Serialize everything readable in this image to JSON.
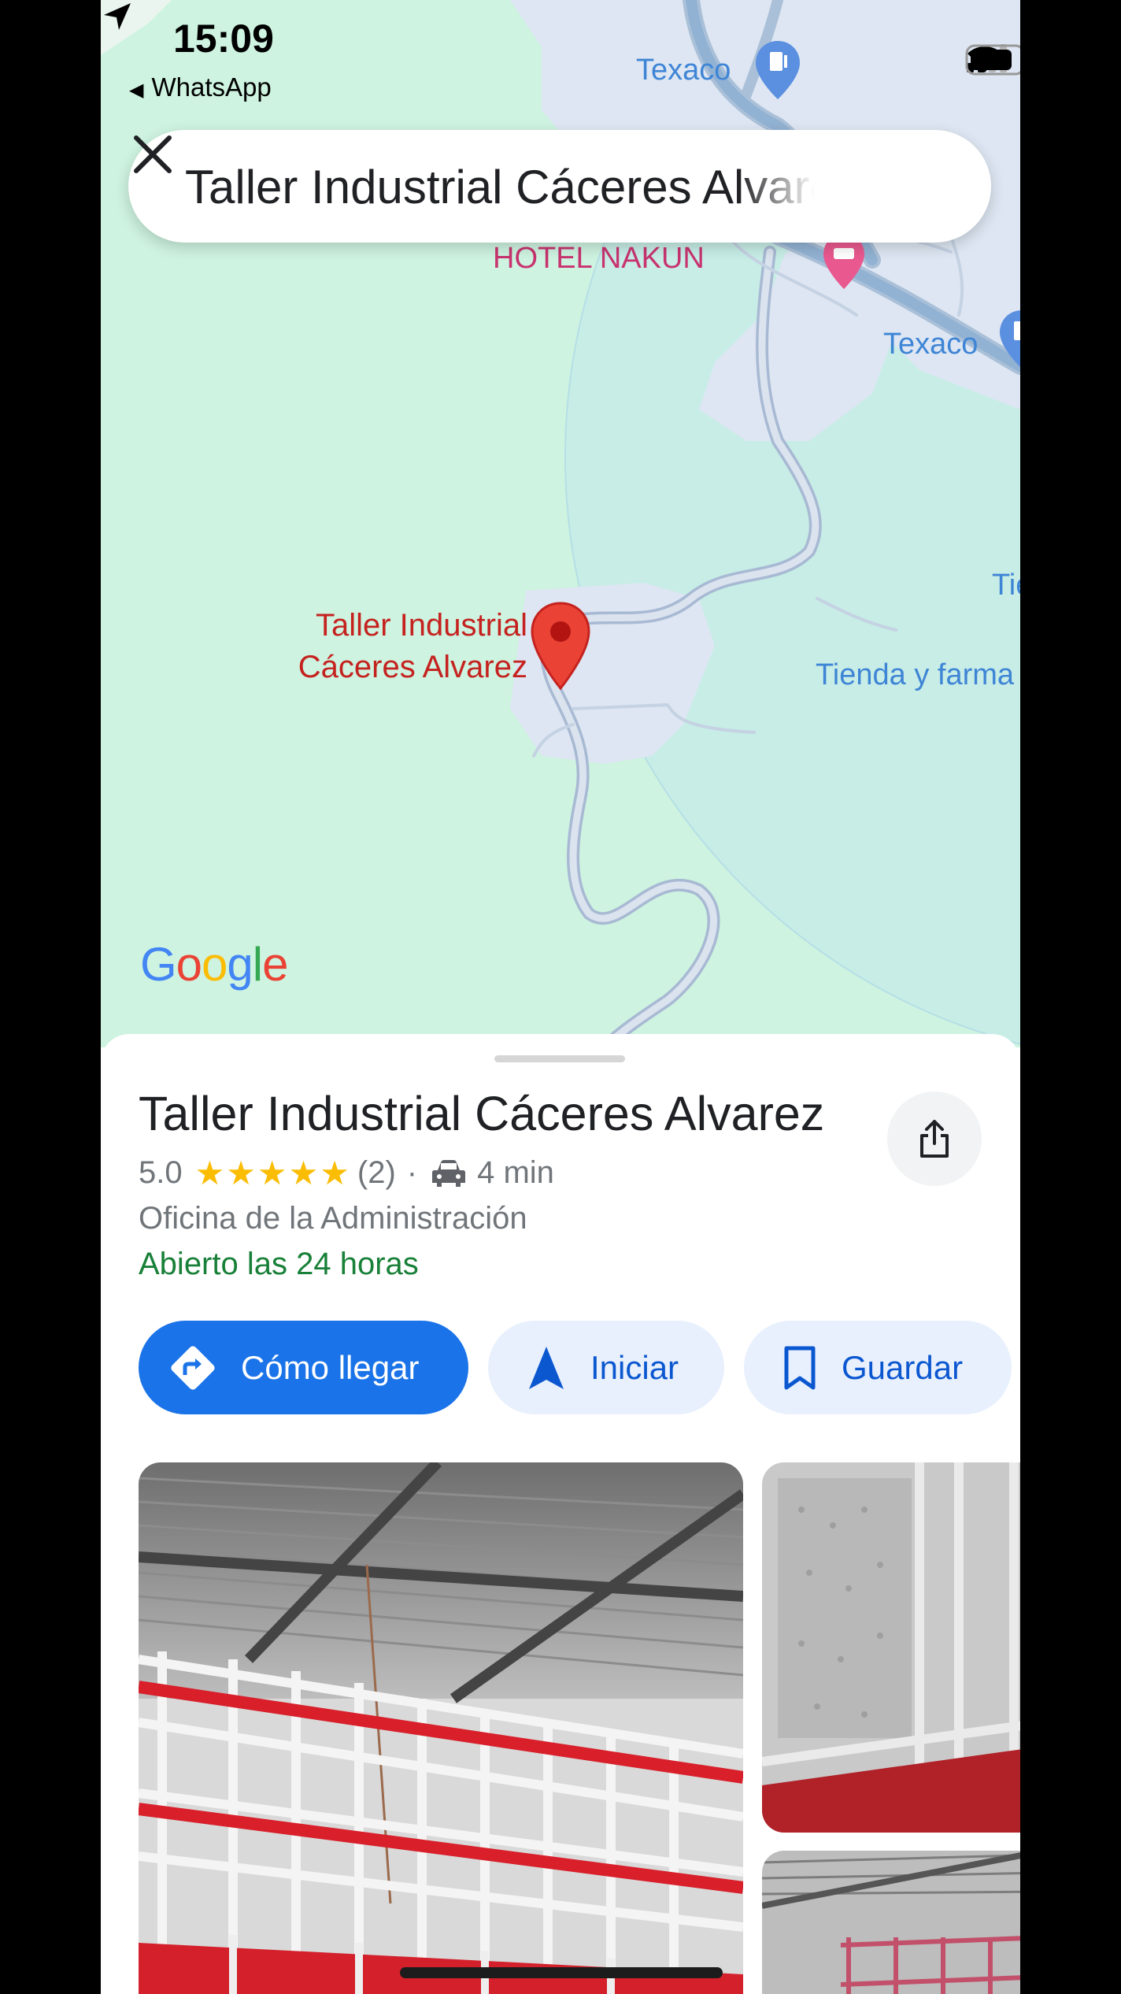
{
  "status_bar": {
    "time": "15:09",
    "back_app": "WhatsApp"
  },
  "search": {
    "query": "Taller Industrial Cáceres Alvarez"
  },
  "map": {
    "labels": {
      "texaco_top": "Texaco",
      "texaco_right": "Texaco",
      "hotel": "HOTEL NAKUN",
      "tie": "Tie",
      "tienda": "Tienda y farma",
      "marker_line1": "Taller Industrial",
      "marker_line2": "Cáceres Alvarez"
    },
    "brand": {
      "g1": "G",
      "o1": "o",
      "o2": "o",
      "g2": "g",
      "l": "l",
      "e": "e"
    }
  },
  "place": {
    "name": "Taller Industrial Cáceres Alvarez",
    "rating": "5.0",
    "stars": "★★★★★",
    "reviews": "(2)",
    "separator": "·",
    "drive_time": "4 min",
    "category": "Oficina de la Administración",
    "hours": "Abierto las 24 horas"
  },
  "actions": {
    "directions": "Cómo llegar",
    "start": "Iniciar",
    "save": "Guardar"
  },
  "colors": {
    "accent": "#1a73e8",
    "open_green": "#188038",
    "star": "#fbbc04",
    "marker": "#ea4335"
  }
}
